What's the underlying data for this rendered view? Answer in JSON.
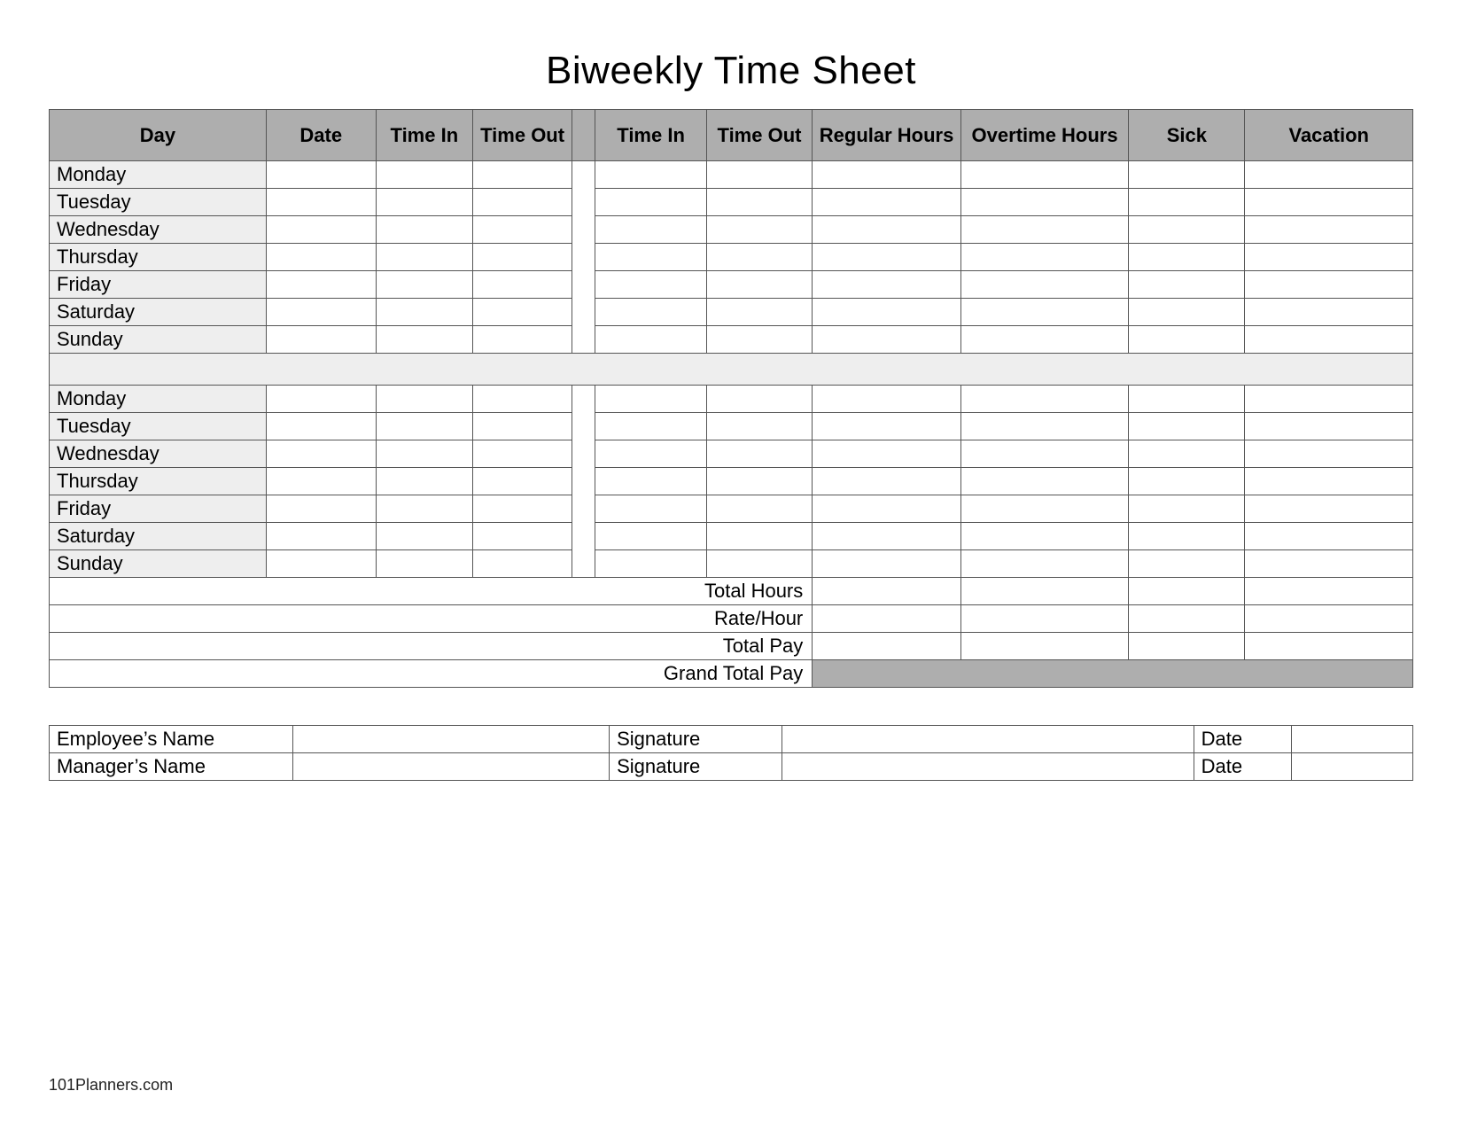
{
  "title": "Biweekly Time Sheet",
  "headers": {
    "day": "Day",
    "date": "Date",
    "time_in": "Time In",
    "time_out": "Time Out",
    "regular_hours": "Regular Hours",
    "overtime_hours": "Overtime Hours",
    "sick": "Sick",
    "vacation": "Vacation"
  },
  "week1": [
    {
      "day": "Monday",
      "date": "",
      "time_in_1": "",
      "time_out_1": "",
      "time_in_2": "",
      "time_out_2": "",
      "regular": "",
      "overtime": "",
      "sick": "",
      "vacation": ""
    },
    {
      "day": "Tuesday",
      "date": "",
      "time_in_1": "",
      "time_out_1": "",
      "time_in_2": "",
      "time_out_2": "",
      "regular": "",
      "overtime": "",
      "sick": "",
      "vacation": ""
    },
    {
      "day": "Wednesday",
      "date": "",
      "time_in_1": "",
      "time_out_1": "",
      "time_in_2": "",
      "time_out_2": "",
      "regular": "",
      "overtime": "",
      "sick": "",
      "vacation": ""
    },
    {
      "day": "Thursday",
      "date": "",
      "time_in_1": "",
      "time_out_1": "",
      "time_in_2": "",
      "time_out_2": "",
      "regular": "",
      "overtime": "",
      "sick": "",
      "vacation": ""
    },
    {
      "day": "Friday",
      "date": "",
      "time_in_1": "",
      "time_out_1": "",
      "time_in_2": "",
      "time_out_2": "",
      "regular": "",
      "overtime": "",
      "sick": "",
      "vacation": ""
    },
    {
      "day": "Saturday",
      "date": "",
      "time_in_1": "",
      "time_out_1": "",
      "time_in_2": "",
      "time_out_2": "",
      "regular": "",
      "overtime": "",
      "sick": "",
      "vacation": ""
    },
    {
      "day": "Sunday",
      "date": "",
      "time_in_1": "",
      "time_out_1": "",
      "time_in_2": "",
      "time_out_2": "",
      "regular": "",
      "overtime": "",
      "sick": "",
      "vacation": ""
    }
  ],
  "week2": [
    {
      "day": "Monday",
      "date": "",
      "time_in_1": "",
      "time_out_1": "",
      "time_in_2": "",
      "time_out_2": "",
      "regular": "",
      "overtime": "",
      "sick": "",
      "vacation": ""
    },
    {
      "day": "Tuesday",
      "date": "",
      "time_in_1": "",
      "time_out_1": "",
      "time_in_2": "",
      "time_out_2": "",
      "regular": "",
      "overtime": "",
      "sick": "",
      "vacation": ""
    },
    {
      "day": "Wednesday",
      "date": "",
      "time_in_1": "",
      "time_out_1": "",
      "time_in_2": "",
      "time_out_2": "",
      "regular": "",
      "overtime": "",
      "sick": "",
      "vacation": ""
    },
    {
      "day": "Thursday",
      "date": "",
      "time_in_1": "",
      "time_out_1": "",
      "time_in_2": "",
      "time_out_2": "",
      "regular": "",
      "overtime": "",
      "sick": "",
      "vacation": ""
    },
    {
      "day": "Friday",
      "date": "",
      "time_in_1": "",
      "time_out_1": "",
      "time_in_2": "",
      "time_out_2": "",
      "regular": "",
      "overtime": "",
      "sick": "",
      "vacation": ""
    },
    {
      "day": "Saturday",
      "date": "",
      "time_in_1": "",
      "time_out_1": "",
      "time_in_2": "",
      "time_out_2": "",
      "regular": "",
      "overtime": "",
      "sick": "",
      "vacation": ""
    },
    {
      "day": "Sunday",
      "date": "",
      "time_in_1": "",
      "time_out_1": "",
      "time_in_2": "",
      "time_out_2": "",
      "regular": "",
      "overtime": "",
      "sick": "",
      "vacation": ""
    }
  ],
  "summary": {
    "total_hours_label": "Total Hours",
    "rate_hour_label": "Rate/Hour",
    "total_pay_label": "Total Pay",
    "grand_total_pay_label": "Grand Total Pay",
    "total_hours": {
      "regular": "",
      "overtime": "",
      "sick": "",
      "vacation": ""
    },
    "rate_hour": {
      "regular": "",
      "overtime": "",
      "sick": "",
      "vacation": ""
    },
    "total_pay": {
      "regular": "",
      "overtime": "",
      "sick": "",
      "vacation": ""
    },
    "grand_total_pay": ""
  },
  "signatures": {
    "employee_name_label": "Employee’s Name",
    "manager_name_label": "Manager’s Name",
    "signature_label": "Signature",
    "date_label": "Date",
    "employee": {
      "name": "",
      "signature": "",
      "date": ""
    },
    "manager": {
      "name": "",
      "signature": "",
      "date": ""
    }
  },
  "footer": "101Planners.com"
}
